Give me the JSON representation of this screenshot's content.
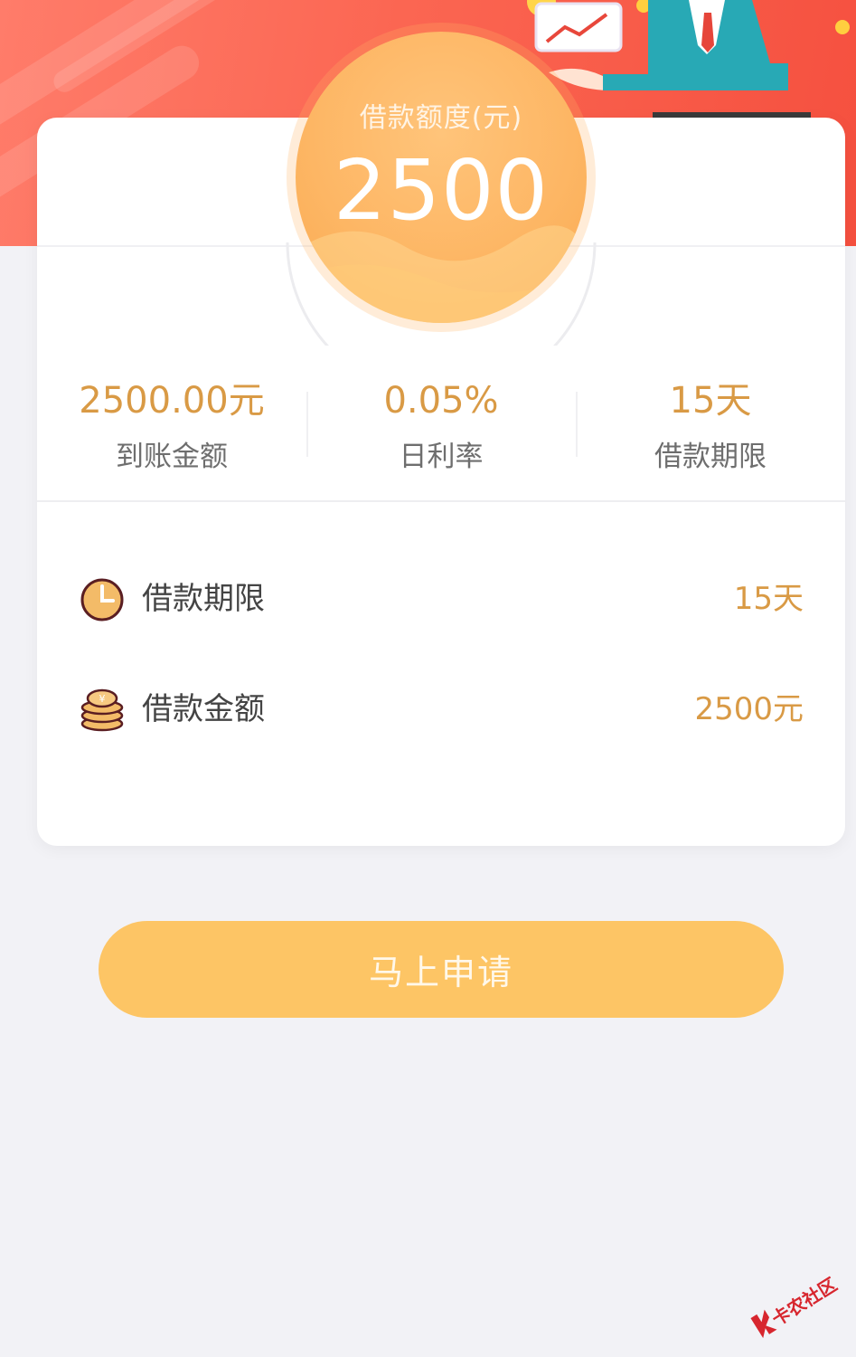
{
  "hero": {
    "limit_caption": "借款额度(元)",
    "limit_amount": "2500"
  },
  "stats": [
    {
      "value": "2500.00元",
      "label": "到账金额"
    },
    {
      "value": "0.05%",
      "label": "日利率"
    },
    {
      "value": "15天",
      "label": "借款期限"
    }
  ],
  "details": {
    "term": {
      "icon": "clock-icon",
      "label": "借款期限",
      "value": "15天"
    },
    "amount": {
      "icon": "coin-stack-icon",
      "label": "借款金额",
      "value": "2500元"
    }
  },
  "apply_button": {
    "label": "马上申请"
  },
  "watermark": {
    "text": "卡农社区"
  },
  "colors": {
    "hero_red": "#fb6652",
    "accent_orange": "#fdb664",
    "value_gold": "#d99a45",
    "button_yellow": "#fdc565",
    "background": "#f2f2f6"
  }
}
